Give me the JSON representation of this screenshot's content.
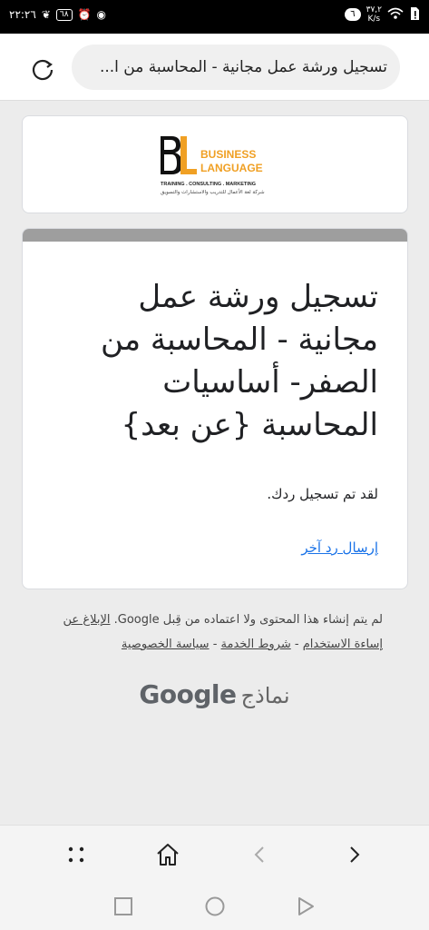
{
  "status_bar": {
    "time": "٢٢:٢٦",
    "battery": "٦٨",
    "notification_count": "٦",
    "speed_value": "٣٧,٢",
    "speed_unit": "K/s"
  },
  "browser": {
    "url_text": "تسجيل ورشة عمل مجانية - المحاسبة من ا..."
  },
  "logo": {
    "brand_line1": "BUSINESS",
    "brand_line2": "LANGUAGE",
    "tagline": "TRAINING . CONSULTING . MARKETING",
    "tagline_ar": "شركة لغة الأعمال للتدريب والاستشارات والتسويق"
  },
  "form": {
    "title": "تسجيل ورشة عمل مجانية - المحاسبة من الصفر- أساسيات المحاسبة {عن بعد}",
    "confirmation": "لقد تم تسجيل ردك.",
    "resubmit_link": "إرسال رد آخر"
  },
  "footer": {
    "disclaimer_text": "لم يتم إنشاء هذا المحتوى ولا اعتماده من قِبل Google.",
    "report_abuse": "الإبلاغ عن إساءة الاستخدام",
    "sep": "-",
    "terms": "شروط الخدمة",
    "privacy": "سياسة الخصوصية",
    "brand_google": "Google",
    "brand_forms": "نماذج"
  },
  "colors": {
    "accent_orange": "#f0a024",
    "link_blue": "#1a73e8",
    "header_band": "#9e9e9e"
  }
}
